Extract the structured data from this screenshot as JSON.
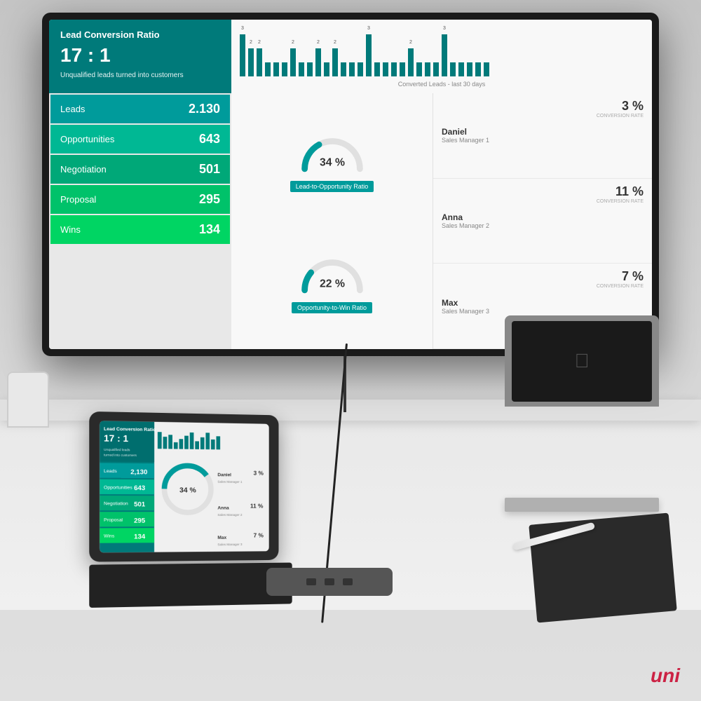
{
  "dashboard": {
    "header": {
      "title": "Lead Conversion Ratio",
      "ratio": "17 : 1",
      "subtitle": "Unqualified leads turned into customers"
    },
    "bar_chart": {
      "title": "Converted Leads - last 30 days",
      "bars": [
        3,
        2,
        2,
        1,
        1,
        1,
        2,
        1,
        1,
        2,
        1,
        2,
        1,
        1,
        1,
        3,
        1,
        1,
        1,
        1,
        2,
        1,
        1,
        1,
        3,
        1,
        1,
        1,
        1,
        1
      ]
    },
    "metrics": [
      {
        "label": "Leads",
        "value": "2.130",
        "class": "leads"
      },
      {
        "label": "Opportunities",
        "value": "643",
        "class": "opportunities"
      },
      {
        "label": "Negotiation",
        "value": "501",
        "class": "negotiation"
      },
      {
        "label": "Proposal",
        "value": "295",
        "class": "proposal"
      },
      {
        "label": "Wins",
        "value": "134",
        "class": "wins"
      }
    ],
    "gauges": [
      {
        "label": "Lead-to-Opportunity Ratio",
        "value": "34 %",
        "pct": 34
      },
      {
        "label": "Opportunity-to-Win Ratio",
        "value": "22 %",
        "pct": 22
      }
    ],
    "managers": [
      {
        "name": "Daniel",
        "title": "Sales Manager 1",
        "rate": "3 %",
        "rate_label": "CONVERSION RATE"
      },
      {
        "name": "Anna",
        "title": "Sales Manager 2",
        "rate": "11 %",
        "rate_label": "CONVERSION RATE"
      },
      {
        "name": "Max",
        "title": "Sales Manager 3",
        "rate": "7 %",
        "rate_label": "CONVERSION RATE"
      }
    ]
  },
  "branding": {
    "logo": "uni"
  }
}
